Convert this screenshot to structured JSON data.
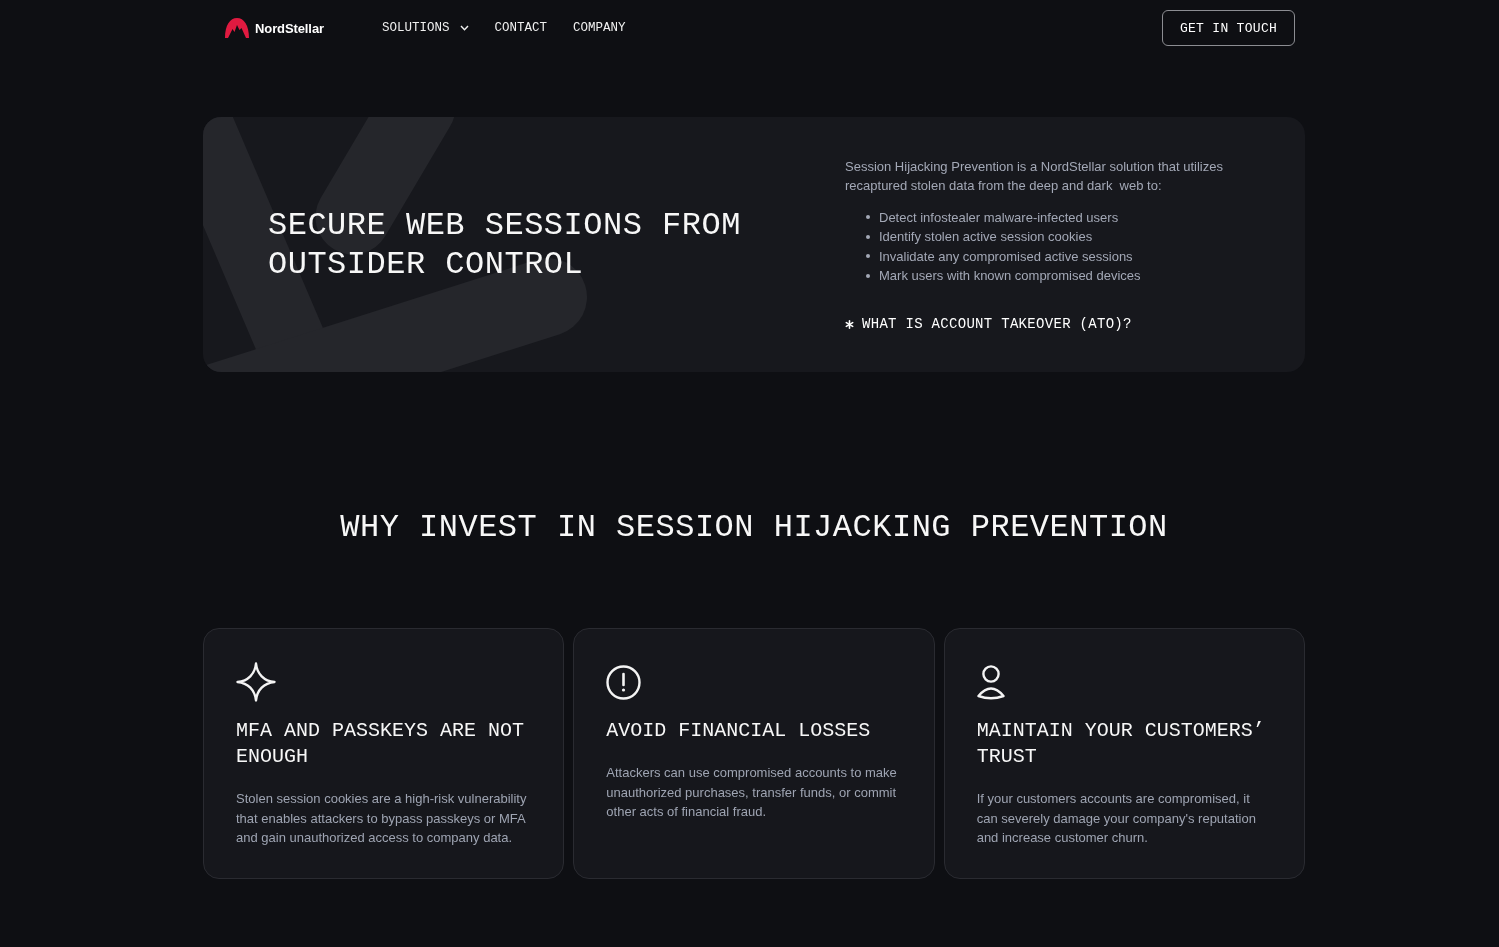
{
  "header": {
    "logo": "NordStellar",
    "nav": [
      {
        "label": "SOLUTIONS",
        "dropdown": true
      },
      {
        "label": "CONTACT",
        "dropdown": false
      },
      {
        "label": "COMPANY",
        "dropdown": false
      }
    ],
    "cta": "GET IN TOUCH"
  },
  "hero": {
    "title": "SECURE WEB SESSIONS FROM OUTSIDER CONTROL",
    "intro": "Session Hijacking Prevention is a NordStellar solution that utilizes recaptured stolen data from the deep and dark  web to:",
    "bullets": [
      "Detect infostealer malware-infected users",
      "Identify stolen active session cookies",
      "Invalidate any compromised active sessions",
      "Mark users with known compromised devices"
    ],
    "link": "WHAT IS ACCOUNT TAKEOVER (ATO)?"
  },
  "benefits": {
    "heading": "WHY INVEST IN SESSION HIJACKING PREVENTION",
    "cards": [
      {
        "title": "MFA AND PASSKEYS ARE NOT ENOUGH",
        "text": "Stolen session cookies are a high-risk vulnerability that enables attackers to bypass passkeys or MFA and gain unauthorized access to company data."
      },
      {
        "title": "AVOID FINANCIAL LOSSES",
        "text": "Attackers can use compromised accounts to make unauthorized purchases, transfer funds, or commit other acts of financial fraud."
      },
      {
        "title": "MAINTAIN YOUR CUSTOMERS’ TRUST",
        "text": "If your customers accounts are compromised, it can severely damage your company's reputation and increase customer churn."
      }
    ]
  }
}
